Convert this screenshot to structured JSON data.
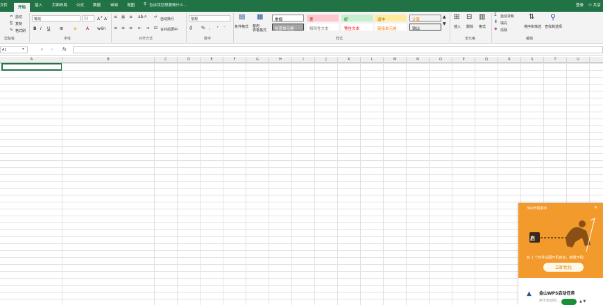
{
  "tabs": [
    "文件",
    "开始",
    "插入",
    "页面布局",
    "公式",
    "数据",
    "审阅",
    "视图"
  ],
  "tell_me": "告诉我您想要做什么...",
  "login": "登录",
  "share": "共享",
  "clipboard": {
    "cut": "剪切",
    "copy": "复制",
    "format_painter": "格式刷",
    "group": "剪贴板"
  },
  "font": {
    "name": "等线",
    "size": "11",
    "group": "字体"
  },
  "alignment": {
    "wrap": "自动换行",
    "merge": "合并后居中",
    "group": "对齐方式"
  },
  "number": {
    "format": "常规",
    "group": "数字"
  },
  "styles": {
    "conditional": "条件格式",
    "table_format": "套用\n表格格式",
    "cells": [
      {
        "label": "常规",
        "bg": "#ffffff",
        "fg": "#000000",
        "border": "#888888"
      },
      {
        "label": "差",
        "bg": "#ffc7ce",
        "fg": "#9c0006",
        "border": "#ffc7ce"
      },
      {
        "label": "好",
        "bg": "#c6efce",
        "fg": "#006100",
        "border": "#c6efce"
      },
      {
        "label": "适中",
        "bg": "#ffeb9c",
        "fg": "#9c6500",
        "border": "#ffeb9c"
      },
      {
        "label": "计算",
        "bg": "#f2f2f2",
        "fg": "#fa7d00",
        "border": "#7f7f7f"
      },
      {
        "label": "检查单元格",
        "bg": "#a5a5a5",
        "fg": "#ffffff",
        "border": "#3f3f3f"
      },
      {
        "label": "解释性文本",
        "bg": "#ffffff",
        "fg": "#7f7f7f",
        "border": "#ffffff"
      },
      {
        "label": "警告文本",
        "bg": "#ffffff",
        "fg": "#ff0000",
        "border": "#ffffff"
      },
      {
        "label": "链接单元格",
        "bg": "#ffffff",
        "fg": "#fa7d00",
        "border": "#ffffff"
      },
      {
        "label": "输出",
        "bg": "#f2f2f2",
        "fg": "#3f3f3f",
        "border": "#3f3f3f"
      }
    ],
    "group": "样式"
  },
  "cells_group": {
    "insert": "插入",
    "delete": "删除",
    "format": "格式",
    "group": "单元格"
  },
  "editing": {
    "autosum": "自动求和",
    "fill": "填充",
    "clear": "清除",
    "sort": "排序和筛选",
    "find": "查找和选择",
    "group": "编辑"
  },
  "name_box": "A1",
  "fx": "fx",
  "columns": [
    "A",
    "B",
    "C",
    "D",
    "E",
    "F",
    "G",
    "H",
    "I",
    "J",
    "K",
    "L",
    "M",
    "N",
    "O",
    "P",
    "Q",
    "R",
    "S",
    "T",
    "U"
  ],
  "popup": {
    "brand": "360开机助手",
    "badge": "启",
    "message": "有 1 个软件试图开机启动，拖慢开机！",
    "button": "立即优化",
    "task_title": "金山WPS启动任务",
    "task_desc": "用于启动时..."
  },
  "colors": {
    "accent": "#217346",
    "popup": "#f29a2c"
  }
}
